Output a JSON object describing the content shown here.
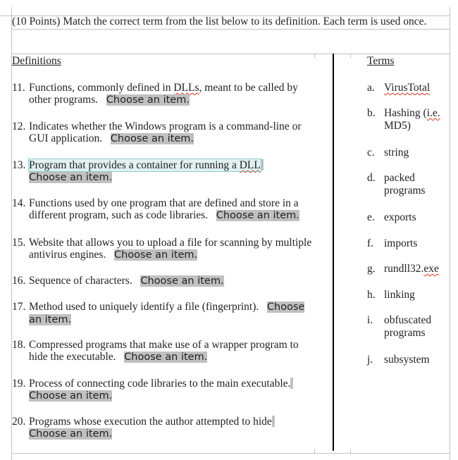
{
  "instruction": "(10 Points) Match the correct term from the list below to its definition. Each term is used once.",
  "headers": {
    "definitions": "Definitions",
    "terms": "Terms"
  },
  "content_control_placeholder": "Choose an item.",
  "definitions": [
    {
      "num": "11.",
      "pre": "Functions, commonly defined in ",
      "flag": "DLLs",
      "post": ", meant to be called by other programs."
    },
    {
      "num": "12.",
      "text": "Indicates whether the Windows program is a command-line or GUI application."
    },
    {
      "num": "13.",
      "pre": "Program that provides a container for running a ",
      "flag": "DLL",
      "post": "",
      "selected": true
    },
    {
      "num": "14.",
      "text": "Functions used by one program that are defined and store in a different program, such as code libraries."
    },
    {
      "num": "15.",
      "text": "Website that allows you to upload a file for scanning by multiple antivirus engines."
    },
    {
      "num": "16.",
      "text": "Sequence of characters."
    },
    {
      "num": "17.",
      "text": "Method used to uniquely identify a file (fingerprint)."
    },
    {
      "num": "18.",
      "text": "Compressed programs that make use of a wrapper program to hide the executable."
    },
    {
      "num": "19.",
      "text": "Process of connecting code libraries to the main executable."
    },
    {
      "num": "20.",
      "text": "Programs whose execution the author attempted to hide"
    }
  ],
  "terms": [
    {
      "letter": "a.",
      "pre": "",
      "flag": "VirusTotal",
      "post": ""
    },
    {
      "letter": "b.",
      "pre": "Hashing (",
      "flag": "i.e.",
      "post": " MD5)"
    },
    {
      "letter": "c.",
      "text": "string"
    },
    {
      "letter": "d.",
      "text": "packed programs"
    },
    {
      "letter": "e.",
      "text": "exports"
    },
    {
      "letter": "f.",
      "text": "imports"
    },
    {
      "letter": "g.",
      "pre": "rundll32.",
      "flag": "exe",
      "post": ""
    },
    {
      "letter": "h.",
      "text": "linking"
    },
    {
      "letter": "i.",
      "text": "obfuscated programs"
    },
    {
      "letter": "j.",
      "text": "subsystem"
    }
  ]
}
